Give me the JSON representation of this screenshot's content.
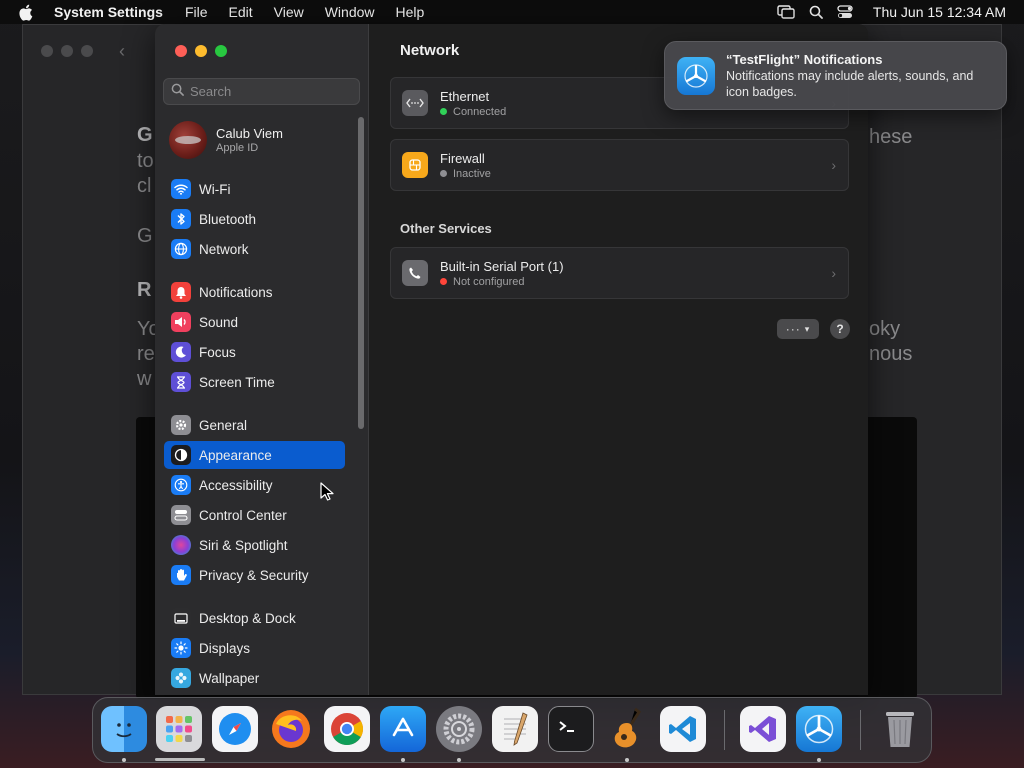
{
  "menubar": {
    "app_name": "System Settings",
    "menus": [
      "File",
      "Edit",
      "View",
      "Window",
      "Help"
    ],
    "clock": "Thu Jun 15  12:34 AM"
  },
  "background_window": {
    "fragments": [
      "G",
      "to",
      "cl",
      "G",
      "R",
      "Yo",
      "re",
      "w",
      "hese",
      "oky",
      "nous"
    ]
  },
  "sidebar": {
    "search_placeholder": "Search",
    "account": {
      "name": "Calub Viem",
      "subtitle": "Apple ID"
    },
    "items": [
      {
        "label": "Wi-Fi",
        "icon": "wifi-icon",
        "color": "#1a7cf5"
      },
      {
        "label": "Bluetooth",
        "icon": "bluetooth-icon",
        "color": "#1a7cf5"
      },
      {
        "label": "Network",
        "icon": "globe-icon",
        "color": "#1a7cf5"
      },
      {
        "label": "Notifications",
        "icon": "bell-icon",
        "color": "#f2413b"
      },
      {
        "label": "Sound",
        "icon": "speaker-icon",
        "color": "#f0405e"
      },
      {
        "label": "Focus",
        "icon": "moon-icon",
        "color": "#5e4fd6"
      },
      {
        "label": "Screen Time",
        "icon": "hourglass-icon",
        "color": "#5e4fd6"
      },
      {
        "label": "General",
        "icon": "gear-icon",
        "color": "#8e8e93"
      },
      {
        "label": "Appearance",
        "icon": "appearance-icon",
        "color": "#1c1c1e",
        "selected": true
      },
      {
        "label": "Accessibility",
        "icon": "accessibility-icon",
        "color": "#1a7cf5"
      },
      {
        "label": "Control Center",
        "icon": "control-center-icon",
        "color": "#8e8e93"
      },
      {
        "label": "Siri & Spotlight",
        "icon": "siri-icon",
        "color": "#8a3fd6"
      },
      {
        "label": "Privacy & Security",
        "icon": "hand-icon",
        "color": "#1a7cf5"
      },
      {
        "label": "Desktop & Dock",
        "icon": "dock-icon",
        "color": "#2c2c2e"
      },
      {
        "label": "Displays",
        "icon": "sun-icon",
        "color": "#1a7cf5"
      },
      {
        "label": "Wallpaper",
        "icon": "flower-icon",
        "color": "#36a8e0"
      }
    ]
  },
  "content": {
    "title": "Network",
    "services": [
      {
        "name": "Ethernet",
        "status": "Connected",
        "status_color": "#30d158",
        "icon": "ethernet-icon",
        "icon_bg": "#5a5a5e"
      },
      {
        "name": "Firewall",
        "status": "Inactive",
        "status_color": "#8e8e93",
        "icon": "firewall-icon",
        "icon_bg": "#f7a81b"
      }
    ],
    "other_title": "Other Services",
    "other_services": [
      {
        "name": "Built-in Serial Port (1)",
        "status": "Not configured",
        "status_color": "#ff453a",
        "icon": "phone-icon",
        "icon_bg": "#6a6a6e"
      }
    ],
    "more_label": "···",
    "help_label": "?"
  },
  "notification": {
    "title": "“TestFlight” Notifications",
    "body": "Notifications may include alerts, sounds, and icon badges.",
    "icon": "testflight-icon"
  },
  "dock": {
    "apps": [
      "finder-icon",
      "launchpad-icon",
      "safari-icon",
      "firefox-icon",
      "chrome-icon",
      "app-store-icon",
      "system-settings-icon",
      "textedit-icon",
      "terminal-icon",
      "garageband-icon",
      "vscode-icon",
      "visual-studio-icon",
      "testflight-icon",
      "trash-icon"
    ]
  }
}
